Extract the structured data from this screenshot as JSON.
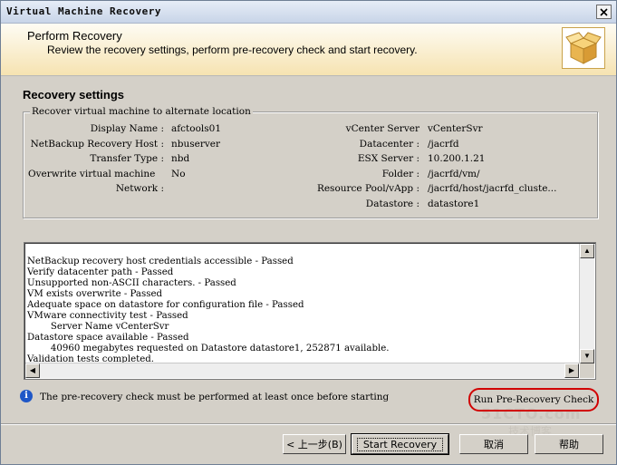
{
  "window": {
    "title": "Virtual Machine Recovery"
  },
  "header": {
    "title": "Perform Recovery",
    "subtitle": "Review the recovery settings, perform pre-recovery check and start recovery."
  },
  "section_title": "Recovery settings",
  "group_label": "Recover virtual machine to alternate location",
  "settings_left": [
    {
      "label": "Display Name :",
      "value": "afctools01"
    },
    {
      "label": "NetBackup Recovery Host :",
      "value": "nbuserver"
    },
    {
      "label": "Transfer Type :",
      "value": "nbd"
    },
    {
      "label": "Overwrite virtual machine",
      "value": "No"
    },
    {
      "label": "Network :",
      "value": ""
    }
  ],
  "settings_right": [
    {
      "label": "vCenter Server",
      "value": "vCenterSvr"
    },
    {
      "label": "Datacenter :",
      "value": "/jacrfd"
    },
    {
      "label": "ESX Server :",
      "value": "10.200.1.21"
    },
    {
      "label": "Folder :",
      "value": "/jacrfd/vm/"
    },
    {
      "label": "Resource Pool/vApp :",
      "value": "/jacrfd/host/jacrfd_cluste..."
    },
    {
      "label": "Datastore :",
      "value": "datastore1"
    }
  ],
  "log_lines": [
    "NetBackup recovery host credentials accessible - Passed",
    "Verify datacenter path - Passed",
    "Unsupported non-ASCII characters. - Passed",
    "VM exists overwrite - Passed",
    "Adequate space on datastore for configuration file - Passed",
    "VMware connectivity test - Passed",
    "        Server Name vCenterSvr",
    "Datastore space available - Passed",
    "        40960 megabytes requested on Datastore datastore1, 252871 available.",
    "Validation tests completed."
  ],
  "info_text": "The pre-recovery check must be performed at least once before starting",
  "buttons": {
    "run_check": "Run Pre-Recovery Check",
    "back": "< 上一步(B)",
    "start": "Start Recovery",
    "cancel": "取消",
    "help": "帮助"
  },
  "watermark": {
    "line1": "51CTO.com",
    "line2": "技术博客"
  },
  "colors": {
    "header_bg": "#f6e3b1",
    "highlight_ring": "#d10000",
    "info_blue": "#1f57c7"
  },
  "icons": {
    "header": "package-box-icon",
    "info": "info-icon",
    "close": "close-icon"
  }
}
